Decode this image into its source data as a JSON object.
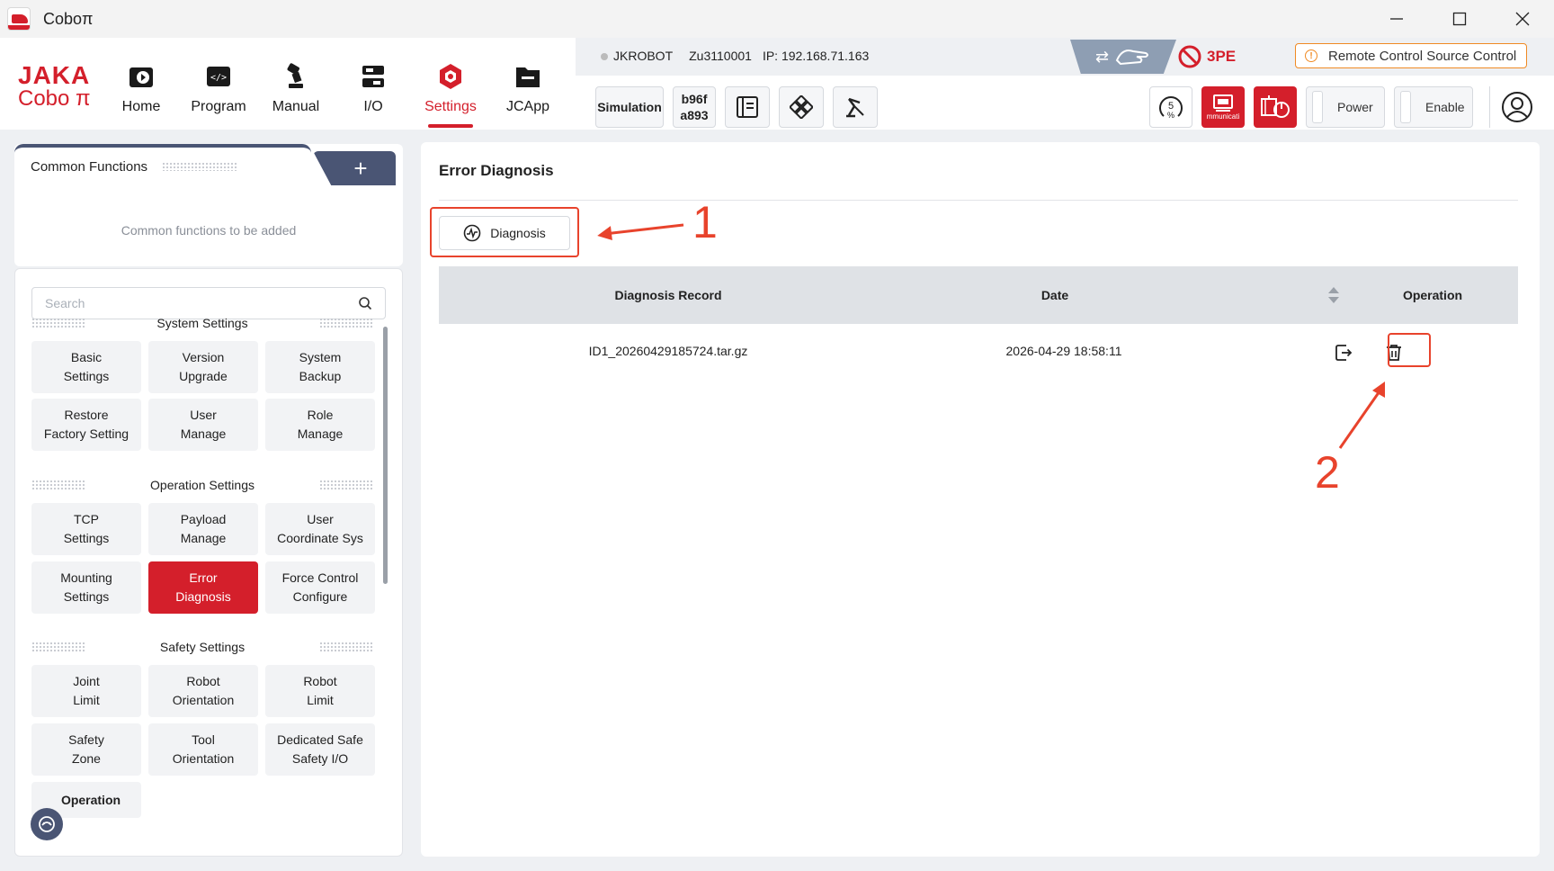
{
  "window": {
    "title": "Coboπ",
    "controls": {
      "minimize": "—",
      "maximize": "□",
      "close": "✕"
    }
  },
  "logo": {
    "line1": "JAKA",
    "line2": "Cobo π"
  },
  "nav": [
    {
      "label": "Home",
      "icon": "home-icon"
    },
    {
      "label": "Program",
      "icon": "program-icon"
    },
    {
      "label": "Manual",
      "icon": "manual-icon"
    },
    {
      "label": "I/O",
      "icon": "io-icon"
    },
    {
      "label": "Settings",
      "icon": "settings-icon",
      "active": true
    },
    {
      "label": "JCApp",
      "icon": "jcapp-icon"
    }
  ],
  "status": {
    "robot_name": "JKROBOT",
    "serial": "Zu3110001",
    "ip": "IP: 192.168.71.163"
  },
  "top_badges": {
    "tpe": "3PE",
    "remote": "Remote Control Source Control"
  },
  "toolbar": {
    "simulation": "Simulation",
    "hash_line1": "b96f",
    "hash_line2": "a893"
  },
  "right_controls": {
    "speed_value": "5",
    "speed_unit": "%",
    "comm_label": "mmunicati",
    "power": "Power",
    "enable": "Enable"
  },
  "common_functions": {
    "title": "Common Functions",
    "add": "+",
    "empty_text": "Common functions to be added"
  },
  "search": {
    "placeholder": "Search"
  },
  "sections": [
    {
      "title": "System Settings",
      "items": [
        [
          "Basic",
          "Settings"
        ],
        [
          "Version",
          "Upgrade"
        ],
        [
          "System",
          "Backup"
        ],
        [
          "Restore",
          "Factory Setting"
        ],
        [
          "User",
          "Manage"
        ],
        [
          "Role",
          "Manage"
        ]
      ]
    },
    {
      "title": "Operation Settings",
      "items": [
        [
          "TCP",
          "Settings"
        ],
        [
          "Payload",
          "Manage"
        ],
        [
          "User",
          "Coordinate Sys"
        ],
        [
          "Mounting",
          "Settings"
        ],
        [
          "Error",
          "Diagnosis"
        ],
        [
          "Force Control",
          "Configure"
        ]
      ]
    },
    {
      "title": "Safety Settings",
      "items": [
        [
          "Joint",
          "Limit"
        ],
        [
          "Robot",
          "Orientation"
        ],
        [
          "Robot",
          "Limit"
        ],
        [
          "Safety",
          "Zone"
        ],
        [
          "Tool",
          "Orientation"
        ],
        [
          "Dedicated Safe",
          "Safety I/O"
        ]
      ]
    }
  ],
  "partial_item": "Operation",
  "main": {
    "title": "Error Diagnosis",
    "diagnosis_button": "Diagnosis",
    "table": {
      "headers": {
        "record": "Diagnosis Record",
        "date": "Date",
        "operation": "Operation"
      },
      "rows": [
        {
          "record": "ID1_20260429185724.tar.gz",
          "date": "2026-04-29 18:58:11"
        }
      ]
    }
  },
  "annotations": {
    "step1": "1",
    "step2": "2"
  },
  "colors": {
    "accent": "#d41f2b",
    "annotation": "#e8432c",
    "nav_dark": "#4a5574"
  }
}
